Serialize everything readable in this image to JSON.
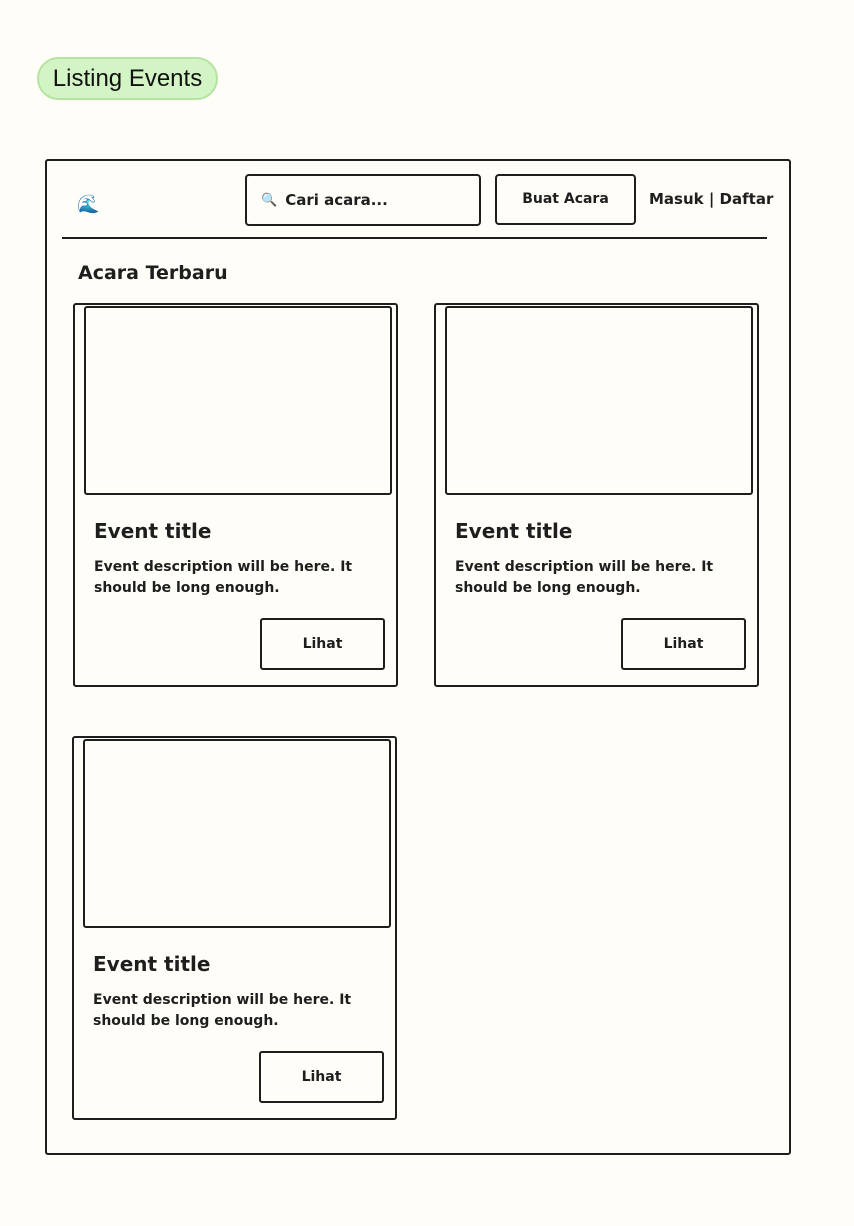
{
  "frame_label": "Listing Events",
  "header": {
    "logo_icon": "🌊",
    "search": {
      "icon": "🔍",
      "placeholder": "Cari acara..."
    },
    "create_button_label": "Buat Acara",
    "auth_links": "Masuk | Daftar"
  },
  "section_title": "Acara Terbaru",
  "events": [
    {
      "title": "Event title",
      "description": "Event description will be here. It should be long enough.",
      "button_label": "Lihat"
    },
    {
      "title": "Event title",
      "description": "Event description will be here. It should be long enough.",
      "button_label": "Lihat"
    },
    {
      "title": "Event title",
      "description": "Event description will be here. It should be long enough.",
      "button_label": "Lihat"
    }
  ]
}
